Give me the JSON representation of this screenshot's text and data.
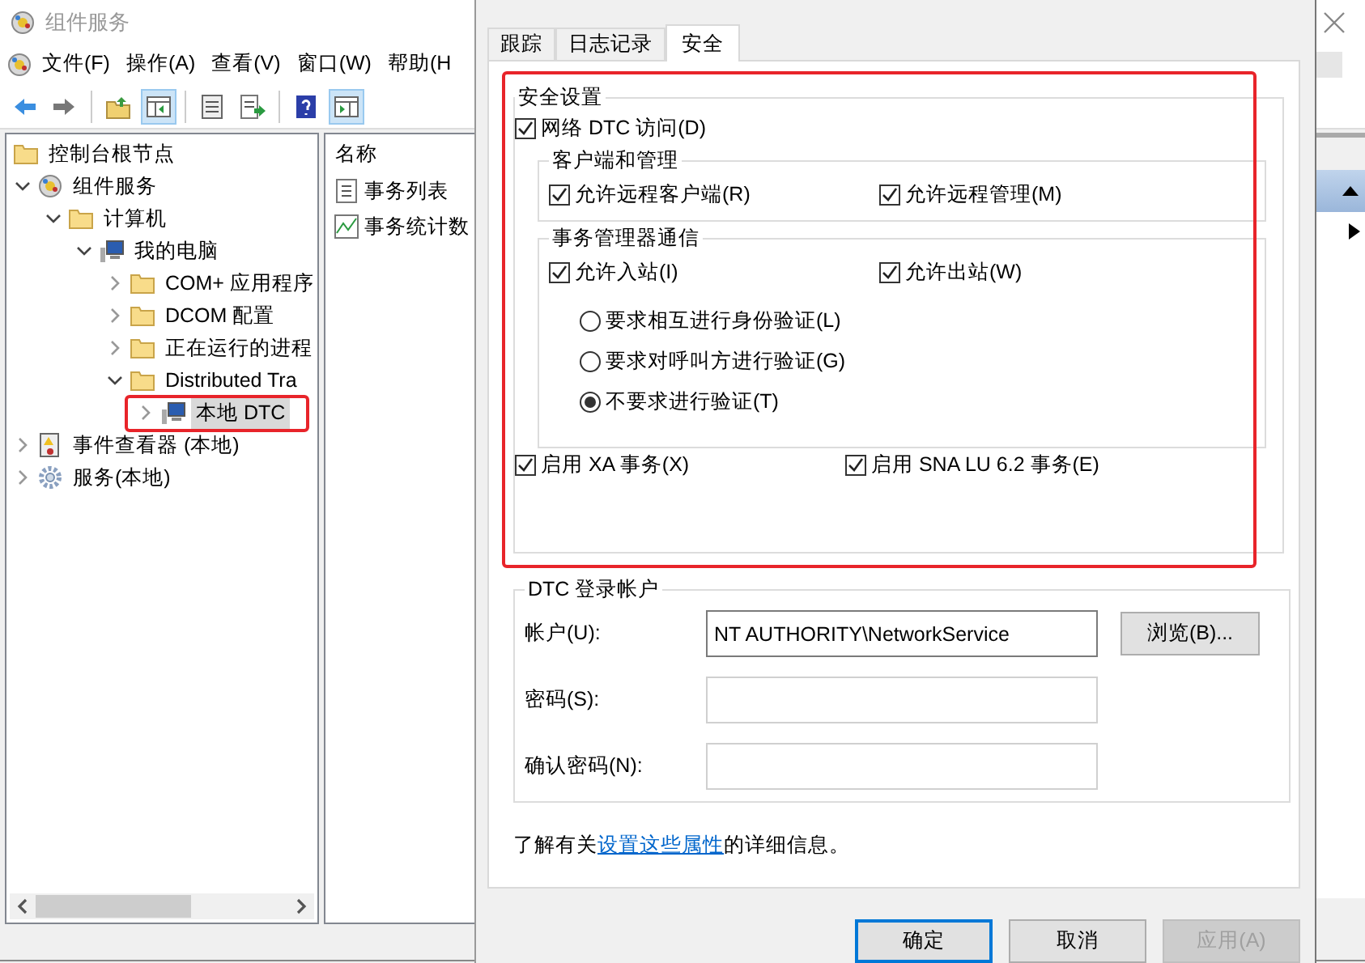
{
  "main_window": {
    "title": "组件服务",
    "menu": [
      "文件(F)",
      "操作(A)",
      "查看(V)",
      "窗口(W)",
      "帮助(H"
    ],
    "toolbar": [
      {
        "kind": "back",
        "pressed": false
      },
      {
        "kind": "forward",
        "pressed": false
      },
      {
        "kind": "up",
        "pressed": false
      },
      {
        "kind": "tree",
        "pressed": true
      },
      {
        "kind": "properties",
        "pressed": false
      },
      {
        "kind": "export",
        "pressed": false
      },
      {
        "kind": "help",
        "pressed": false
      },
      {
        "kind": "actions",
        "pressed": true
      }
    ],
    "tree": [
      {
        "label": "控制台根节点",
        "kind": "folder",
        "selected": false,
        "children": [
          {
            "label": "组件服务",
            "kind": "component",
            "expanded": true,
            "selected": false,
            "children": [
              {
                "label": "计算机",
                "kind": "folder",
                "expanded": true,
                "selected": false,
                "children": [
                  {
                    "label": "我的电脑",
                    "kind": "computer",
                    "expanded": true,
                    "selected": false,
                    "children": [
                      {
                        "label": "COM+ 应用程序",
                        "kind": "folder",
                        "expanded": false,
                        "selected": false
                      },
                      {
                        "label": "DCOM 配置",
                        "kind": "folder",
                        "expanded": false,
                        "selected": false
                      },
                      {
                        "label": "正在运行的进程",
                        "kind": "folder",
                        "expanded": false,
                        "selected": false
                      },
                      {
                        "label": "Distributed Tra",
                        "kind": "folder",
                        "expanded": true,
                        "selected": false,
                        "children": [
                          {
                            "label": "本地 DTC",
                            "kind": "computer",
                            "expanded": false,
                            "selected": true
                          }
                        ]
                      }
                    ]
                  }
                ]
              }
            ]
          },
          {
            "label": "事件查看器 (本地)",
            "kind": "event",
            "expanded": false,
            "selected": false
          },
          {
            "label": "服务(本地)",
            "kind": "gear",
            "expanded": false,
            "selected": false
          }
        ]
      }
    ],
    "list": {
      "column": "名称",
      "items": [
        {
          "label": "事务列表",
          "kind": "list"
        },
        {
          "label": "事务统计数",
          "kind": "stats"
        }
      ]
    }
  },
  "dialog": {
    "tabs": [
      {
        "label": "跟踪",
        "selected": false
      },
      {
        "label": "日志记录",
        "selected": false
      },
      {
        "label": "安全",
        "selected": true
      }
    ],
    "security": {
      "title": "安全设置",
      "network_access": {
        "label": "网络 DTC 访问(D)",
        "checked": true
      },
      "client_admin": {
        "title": "客户端和管理",
        "options": [
          {
            "label": "允许远程客户端(R)",
            "checked": true
          },
          {
            "label": "允许远程管理(M)",
            "checked": true
          }
        ]
      },
      "tm_communication": {
        "title": "事务管理器通信",
        "options": [
          {
            "label": "允许入站(I)",
            "checked": true
          },
          {
            "label": "允许出站(W)",
            "checked": true
          }
        ],
        "auth": [
          {
            "label": "要求相互进行身份验证(L)",
            "selected": false
          },
          {
            "label": "要求对呼叫方进行验证(G)",
            "selected": false
          },
          {
            "label": "不要求进行验证(T)",
            "selected": true
          }
        ]
      },
      "bottom_options": [
        {
          "label": "启用 XA 事务(X)",
          "checked": true
        },
        {
          "label": "启用 SNA LU 6.2 事务(E)",
          "checked": true
        }
      ]
    },
    "account": {
      "title": "DTC 登录帐户",
      "fields": [
        {
          "label": "帐户(U):",
          "value": "NT AUTHORITY\\NetworkService"
        },
        {
          "label": "密码(S):"
        },
        {
          "label": "确认密码(N):"
        }
      ],
      "browse": "浏览(B)..."
    },
    "info": {
      "before": "了解有关",
      "link": "设置这些属性",
      "after": "的详细信息。"
    },
    "buttons": [
      {
        "label": "确定",
        "kind": "default"
      },
      {
        "label": "取消",
        "kind": "normal"
      },
      {
        "label": "应用(A)",
        "kind": "disabled"
      }
    ]
  }
}
